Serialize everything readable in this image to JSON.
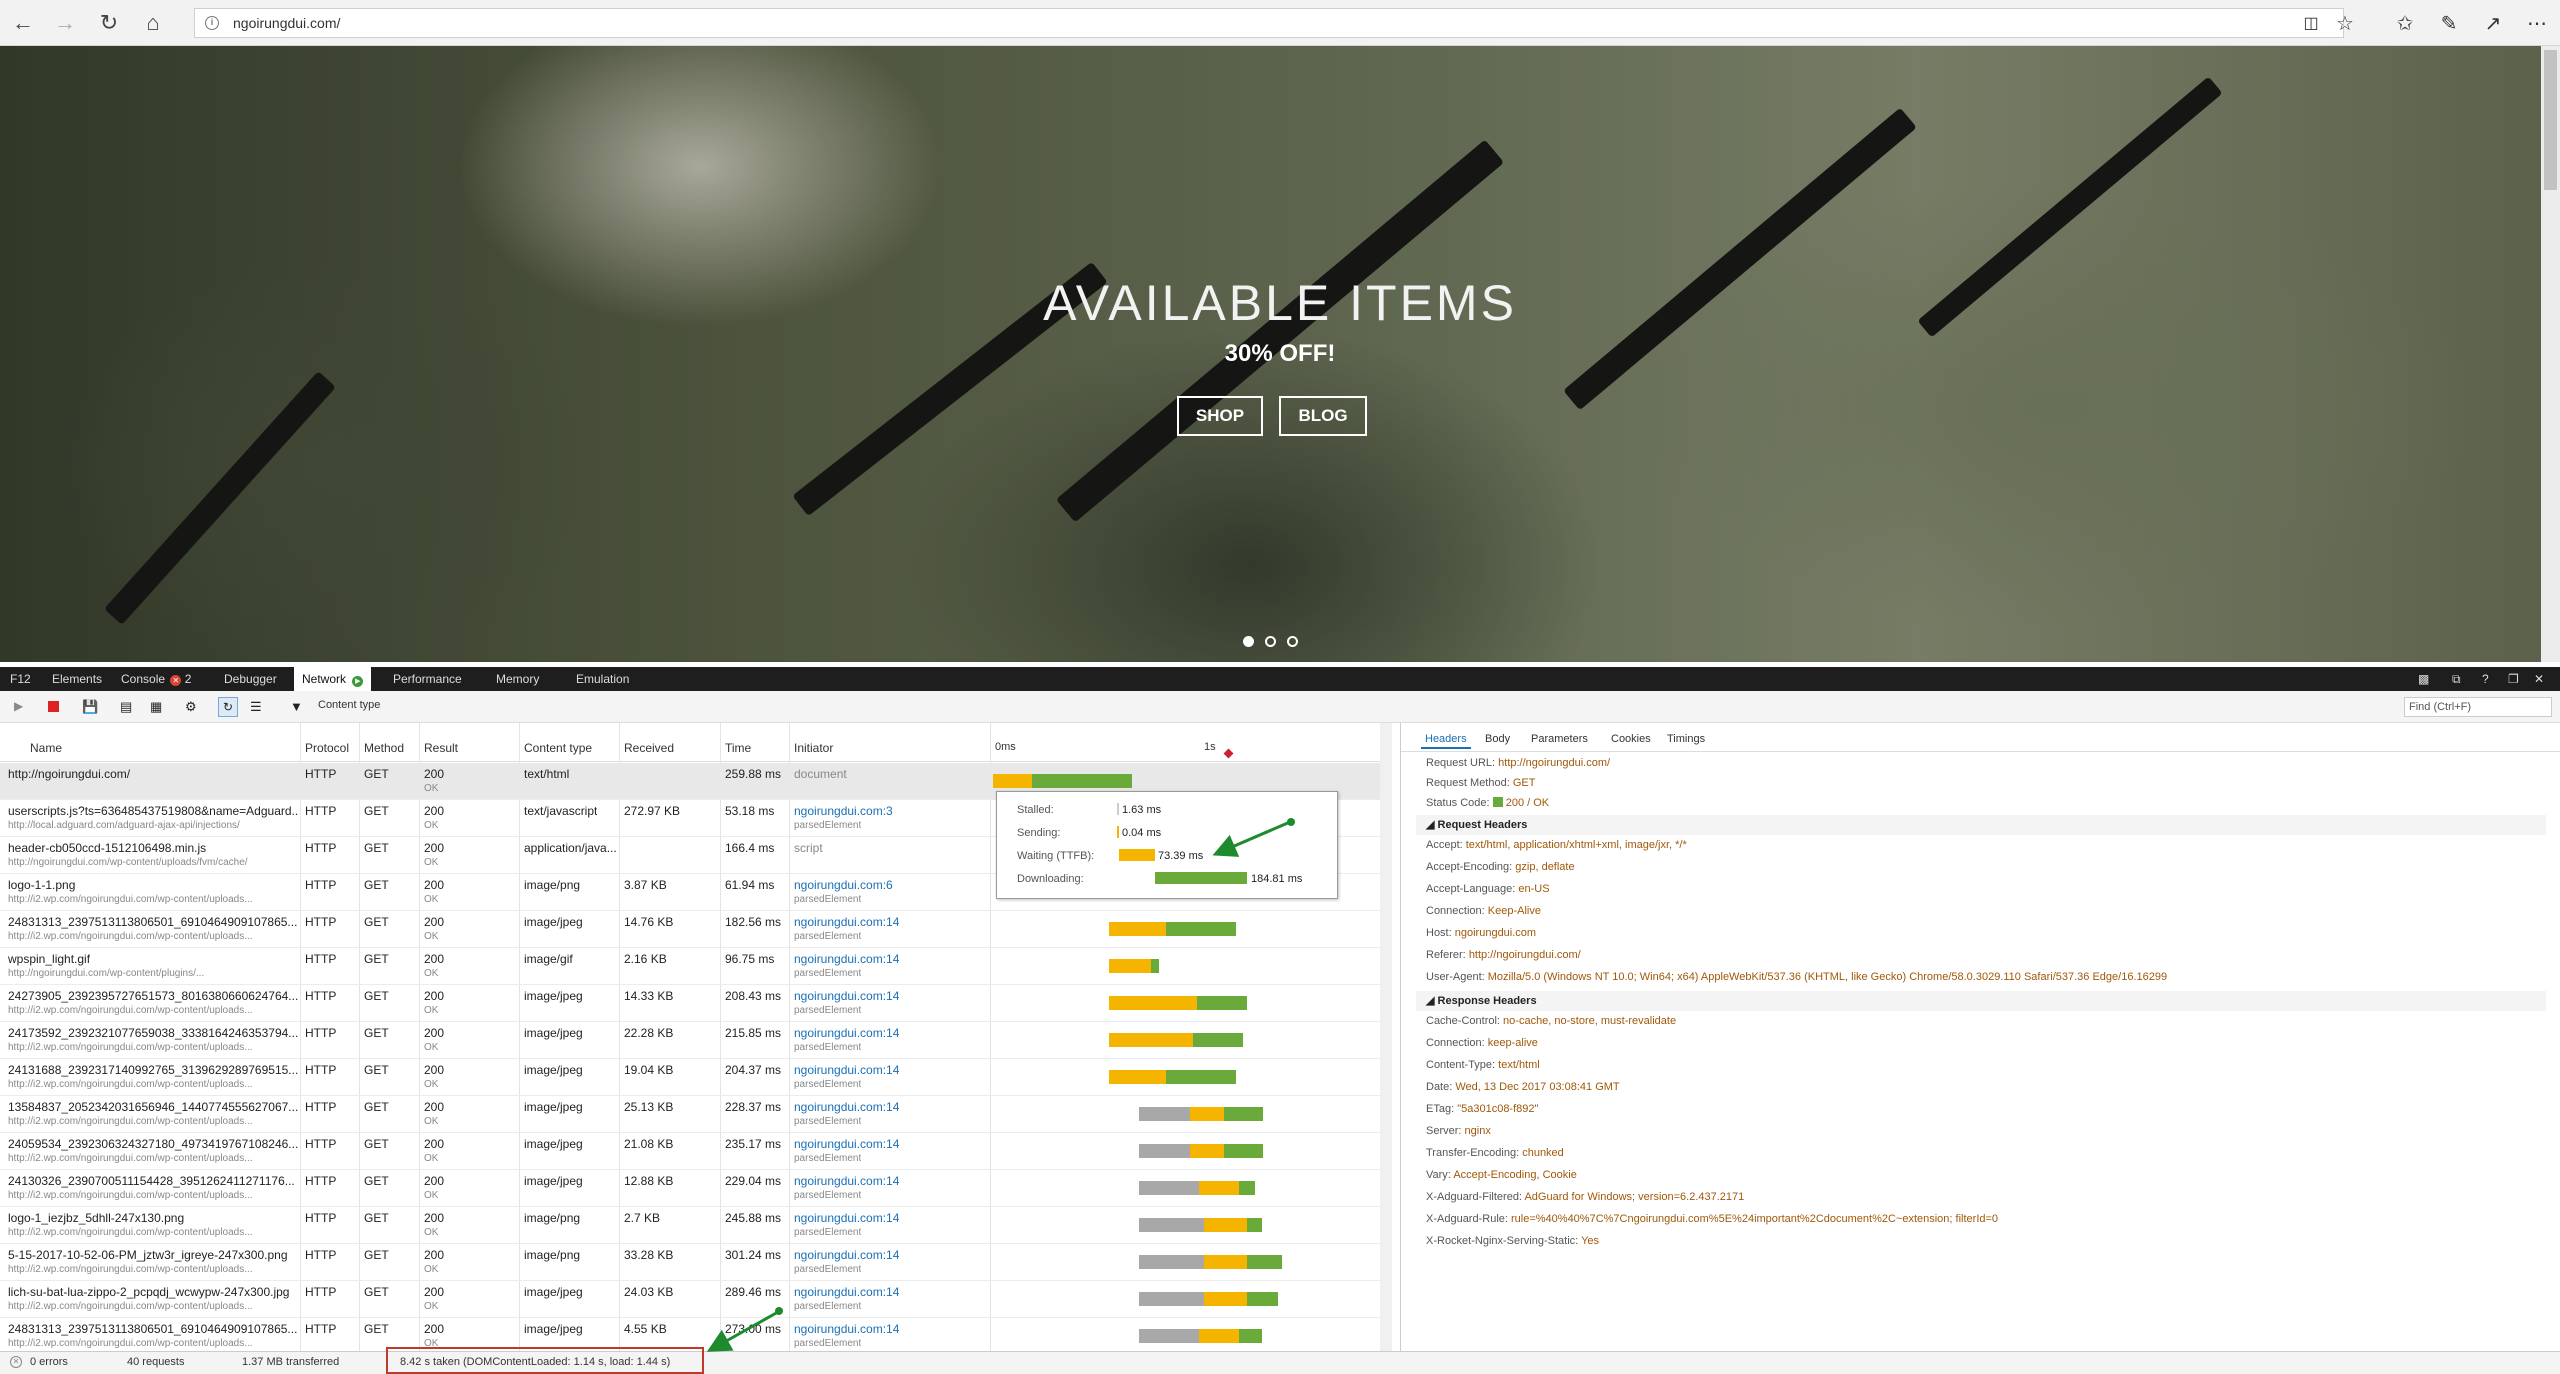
{
  "browser": {
    "url": "ngoirungdui.com/"
  },
  "hero": {
    "title": "AVAILABLE ITEMS",
    "subtitle": "30% OFF!",
    "buttons": [
      "SHOP",
      "BLOG"
    ],
    "slides": 3,
    "active_slide": 1
  },
  "devtools": {
    "label": "F12",
    "tabs": [
      "Elements",
      "Console",
      "Debugger",
      "Network",
      "Performance",
      "Memory",
      "Emulation"
    ],
    "console_badge": "2",
    "active_tab": "Network",
    "filter_label": "Content type",
    "find_placeholder": "Find (Ctrl+F)",
    "columns": [
      "Name",
      "Protocol",
      "Method",
      "Result",
      "Content type",
      "Received",
      "Time",
      "Initiator"
    ],
    "timeline_ticks": [
      "0ms",
      "1s"
    ],
    "requests": [
      {
        "name": "http://ngoirungdui.com/",
        "sub": "",
        "protocol": "HTTP",
        "method": "GET",
        "result": "200",
        "result_sub": "OK",
        "type": "text/html",
        "received": "",
        "time": "259.88 ms",
        "initiator": "document",
        "initiator_sub": "",
        "wait_frac": [
          0.0,
          0.01
        ],
        "down_frac": [
          0.01,
          0.036
        ]
      },
      {
        "name": "userscripts.js?ts=636485437519808&name=Adguard...",
        "sub": "http://local.adguard.com/adguard-ajax-api/injections/",
        "protocol": "HTTP",
        "method": "GET",
        "result": "200",
        "result_sub": "OK",
        "type": "text/javascript",
        "received": "272.97 KB",
        "time": "53.18 ms",
        "initiator": "ngoirungdui.com:3",
        "initiator_sub": "parsedElement",
        "wait_frac": [
          0.025,
          0.028
        ],
        "down_frac": [
          0.028,
          0.052
        ]
      },
      {
        "name": "header-cb050ccd-1512106498.min.js",
        "sub": "http://ngoirungdui.com/wp-content/uploads/fvm/cache/",
        "protocol": "HTTP",
        "method": "GET",
        "result": "200",
        "result_sub": "OK",
        "type": "application/java...",
        "received": "",
        "time": "166.4 ms",
        "initiator": "script",
        "initiator_sub": "",
        "wait_frac": [
          0.03,
          0.04
        ],
        "down_frac": [
          0.04,
          0.056
        ]
      },
      {
        "name": "logo-1-1.png",
        "sub": "http://i2.wp.com/ngoirungdui.com/wp-content/uploads...",
        "protocol": "HTTP",
        "method": "GET",
        "result": "200",
        "result_sub": "OK",
        "type": "image/png",
        "received": "3.87 KB",
        "time": "61.94 ms",
        "initiator": "ngoirungdui.com:6",
        "initiator_sub": "parsedElement",
        "wait_frac": [
          0.028,
          0.033
        ],
        "down_frac": [
          0.033,
          0.046
        ]
      },
      {
        "name": "24831313_2397513113806501_6910464909107865...",
        "sub": "http://i2.wp.com/ngoirungdui.com/wp-content/uploads...",
        "protocol": "HTTP",
        "method": "GET",
        "result": "200",
        "result_sub": "OK",
        "type": "image/jpeg",
        "received": "14.76 KB",
        "time": "182.56 ms",
        "initiator": "ngoirungdui.com:14",
        "initiator_sub": "parsedElement",
        "wait_frac": [
          0.03,
          0.045
        ],
        "down_frac": [
          0.045,
          0.063
        ]
      },
      {
        "name": "wpspin_light.gif",
        "sub": "http://ngoirungdui.com/wp-content/plugins/...",
        "protocol": "HTTP",
        "method": "GET",
        "result": "200",
        "result_sub": "OK",
        "type": "image/gif",
        "received": "2.16 KB",
        "time": "96.75 ms",
        "initiator": "ngoirungdui.com:14",
        "initiator_sub": "parsedElement",
        "wait_frac": [
          0.03,
          0.041
        ],
        "down_frac": [
          0.041,
          0.043
        ]
      },
      {
        "name": "24273905_2392395727651573_8016380660624764...",
        "sub": "http://i2.wp.com/ngoirungdui.com/wp-content/uploads...",
        "protocol": "HTTP",
        "method": "GET",
        "result": "200",
        "result_sub": "OK",
        "type": "image/jpeg",
        "received": "14.33 KB",
        "time": "208.43 ms",
        "initiator": "ngoirungdui.com:14",
        "initiator_sub": "parsedElement",
        "wait_frac": [
          0.03,
          0.053
        ],
        "down_frac": [
          0.053,
          0.066
        ]
      },
      {
        "name": "24173592_2392321077659038_3338164246353794...",
        "sub": "http://i2.wp.com/ngoirungdui.com/wp-content/uploads...",
        "protocol": "HTTP",
        "method": "GET",
        "result": "200",
        "result_sub": "OK",
        "type": "image/jpeg",
        "received": "22.28 KB",
        "time": "215.85 ms",
        "initiator": "ngoirungdui.com:14",
        "initiator_sub": "parsedElement",
        "wait_frac": [
          0.03,
          0.052
        ],
        "down_frac": [
          0.052,
          0.065
        ]
      },
      {
        "name": "24131688_2392317140992765_3139629289769515...",
        "sub": "http://i2.wp.com/ngoirungdui.com/wp-content/uploads...",
        "protocol": "HTTP",
        "method": "GET",
        "result": "200",
        "result_sub": "OK",
        "type": "image/jpeg",
        "received": "19.04 KB",
        "time": "204.37 ms",
        "initiator": "ngoirungdui.com:14",
        "initiator_sub": "parsedElement",
        "wait_frac": [
          0.03,
          0.045
        ],
        "down_frac": [
          0.045,
          0.063
        ]
      },
      {
        "name": "13584837_2052342031656946_1440774555627067...",
        "sub": "http://i2.wp.com/ngoirungdui.com/wp-content/uploads...",
        "protocol": "HTTP",
        "method": "GET",
        "result": "200",
        "result_sub": "OK",
        "type": "image/jpeg",
        "received": "25.13 KB",
        "time": "228.37 ms",
        "initiator": "ngoirungdui.com:14",
        "initiator_sub": "parsedElement",
        "wait_frac": [
          0.038,
          0.06
        ],
        "down_frac": [
          0.06,
          0.07
        ]
      },
      {
        "name": "24059534_2392306324327180_4973419767108246...",
        "sub": "http://i2.wp.com/ngoirungdui.com/wp-content/uploads...",
        "protocol": "HTTP",
        "method": "GET",
        "result": "200",
        "result_sub": "OK",
        "type": "image/jpeg",
        "received": "21.08 KB",
        "time": "235.17 ms",
        "initiator": "ngoirungdui.com:14",
        "initiator_sub": "parsedElement",
        "wait_frac": [
          0.038,
          0.06
        ],
        "down_frac": [
          0.06,
          0.07
        ]
      },
      {
        "name": "24130326_2390700511154428_3951262411271176...",
        "sub": "http://i2.wp.com/ngoirungdui.com/wp-content/uploads...",
        "protocol": "HTTP",
        "method": "GET",
        "result": "200",
        "result_sub": "OK",
        "type": "image/jpeg",
        "received": "12.88 KB",
        "time": "229.04 ms",
        "initiator": "ngoirungdui.com:14",
        "initiator_sub": "parsedElement",
        "wait_frac": [
          0.038,
          0.064
        ],
        "down_frac": [
          0.064,
          0.068
        ]
      },
      {
        "name": "logo-1_iezjbz_5dhll-247x130.png",
        "sub": "http://i2.wp.com/ngoirungdui.com/wp-content/uploads...",
        "protocol": "HTTP",
        "method": "GET",
        "result": "200",
        "result_sub": "OK",
        "type": "image/png",
        "received": "2.7 KB",
        "time": "245.88 ms",
        "initiator": "ngoirungdui.com:14",
        "initiator_sub": "parsedElement",
        "wait_frac": [
          0.038,
          0.066
        ],
        "down_frac": [
          0.066,
          0.07
        ]
      },
      {
        "name": "5-15-2017-10-52-06-PM_jztw3r_igreye-247x300.png",
        "sub": "http://i2.wp.com/ngoirungdui.com/wp-content/uploads...",
        "protocol": "HTTP",
        "method": "GET",
        "result": "200",
        "result_sub": "OK",
        "type": "image/png",
        "received": "33.28 KB",
        "time": "301.24 ms",
        "initiator": "ngoirungdui.com:14",
        "initiator_sub": "parsedElement",
        "wait_frac": [
          0.038,
          0.066
        ],
        "down_frac": [
          0.066,
          0.075
        ]
      },
      {
        "name": "lich-su-bat-lua-zippo-2_pcpqdj_wcwypw-247x300.jpg",
        "sub": "http://i2.wp.com/ngoirungdui.com/wp-content/uploads...",
        "protocol": "HTTP",
        "method": "GET",
        "result": "200",
        "result_sub": "OK",
        "type": "image/jpeg",
        "received": "24.03 KB",
        "time": "289.46 ms",
        "initiator": "ngoirungdui.com:14",
        "initiator_sub": "parsedElement",
        "wait_frac": [
          0.038,
          0.066
        ],
        "down_frac": [
          0.066,
          0.074
        ]
      },
      {
        "name": "24831313_2397513113806501_6910464909107865...",
        "sub": "http://i2.wp.com/ngoirungdui.com/wp-content/uploads...",
        "protocol": "HTTP",
        "method": "GET",
        "result": "200",
        "result_sub": "OK",
        "type": "image/jpeg",
        "received": "4.55 KB",
        "time": "273.00 ms",
        "initiator": "ngoirungdui.com:14",
        "initiator_sub": "parsedElement",
        "wait_frac": [
          0.038,
          0.064
        ],
        "down_frac": [
          0.064,
          0.07
        ]
      }
    ],
    "timing_tooltip": {
      "stalled_label": "Stalled:",
      "stalled": "1.63 ms",
      "sending_label": "Sending:",
      "sending": "0.04 ms",
      "waiting_label": "Waiting (TTFB):",
      "waiting": "73.39 ms",
      "downloading_label": "Downloading:",
      "downloading": "184.81 ms"
    },
    "details_tabs": [
      "Headers",
      "Body",
      "Parameters",
      "Cookies",
      "Timings"
    ],
    "general": [
      {
        "k": "Request URL:",
        "v": "http://ngoirungdui.com/"
      },
      {
        "k": "Request Method:",
        "v": "GET"
      },
      {
        "k": "Status Code:",
        "v": "200 / OK"
      }
    ],
    "request_headers_title": "Request Headers",
    "request_headers": [
      {
        "k": "Accept:",
        "v": "text/html, application/xhtml+xml, image/jxr, */*"
      },
      {
        "k": "Accept-Encoding:",
        "v": "gzip, deflate"
      },
      {
        "k": "Accept-Language:",
        "v": "en-US"
      },
      {
        "k": "Connection:",
        "v": "Keep-Alive"
      },
      {
        "k": "Host:",
        "v": "ngoirungdui.com"
      },
      {
        "k": "Referer:",
        "v": "http://ngoirungdui.com/"
      },
      {
        "k": "User-Agent:",
        "v": "Mozilla/5.0 (Windows NT 10.0; Win64; x64) AppleWebKit/537.36 (KHTML, like Gecko) Chrome/58.0.3029.110 Safari/537.36 Edge/16.16299"
      }
    ],
    "response_headers_title": "Response Headers",
    "response_headers": [
      {
        "k": "Cache-Control:",
        "v": "no-cache, no-store, must-revalidate"
      },
      {
        "k": "Connection:",
        "v": "keep-alive"
      },
      {
        "k": "Content-Type:",
        "v": "text/html"
      },
      {
        "k": "Date:",
        "v": "Wed, 13 Dec 2017 03:08:41 GMT"
      },
      {
        "k": "ETag:",
        "v": "\"5a301c08-f892\""
      },
      {
        "k": "Server:",
        "v": "nginx"
      },
      {
        "k": "Transfer-Encoding:",
        "v": "chunked"
      },
      {
        "k": "Vary:",
        "v": "Accept-Encoding, Cookie"
      },
      {
        "k": "X-Adguard-Filtered:",
        "v": "AdGuard for Windows; version=6.2.437.2171"
      },
      {
        "k": "X-Adguard-Rule:",
        "v": "rule=%40%40%7C%7Cngoirungdui.com%5E%24important%2Cdocument%2C~extension; filterId=0"
      },
      {
        "k": "X-Rocket-Nginx-Serving-Static:",
        "v": "Yes"
      }
    ],
    "status": {
      "errors": "0 errors",
      "requests": "40 requests",
      "transferred": "1.37 MB transferred",
      "taken": "8.42 s taken (DOMContentLoaded: 1.14 s, load: 1.44 s)"
    }
  },
  "colors": {
    "waiting": "#f4b400",
    "downloading": "#6aaa3a",
    "queued": "#a8a8a8",
    "highlight": "#c0392b",
    "arrow": "#1e8a2e"
  }
}
